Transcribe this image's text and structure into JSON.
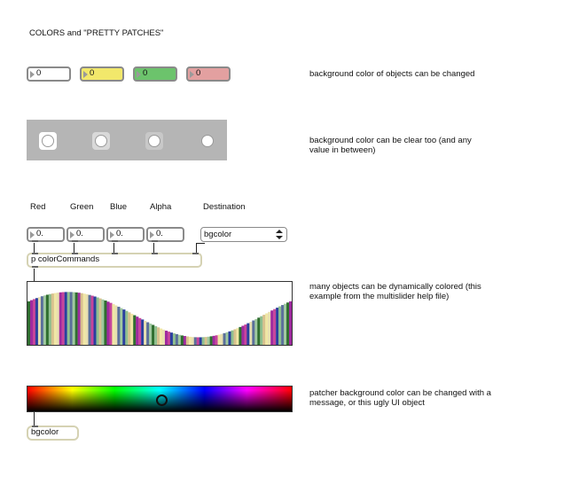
{
  "title": "COLORS and \"PRETTY PATCHES\"",
  "number_boxes": [
    {
      "value": "0",
      "color": "#ffffff"
    },
    {
      "value": "0",
      "color": "#f2e86b"
    },
    {
      "value": "0",
      "color": "#6cc36c"
    },
    {
      "value": "0",
      "color": "#e3a0a0"
    }
  ],
  "comments": {
    "bg_objects": "background color of objects can be changed",
    "bg_clear": "background color can be clear too (and any value in between)",
    "dynamic": "many objects can be dynamically colored (this example from the multislider help file)",
    "patcher_bg": "patcher background color can be changed with a message, or this ugly UI object"
  },
  "toggle_backgrounds": [
    "#ffffff",
    "#d9d9d9",
    "#c8c8c8",
    "#b5b5b5"
  ],
  "channel_labels": {
    "red": "Red",
    "green": "Green",
    "blue": "Blue",
    "alpha": "Alpha",
    "destination": "Destination"
  },
  "channel_values": {
    "red": "0.",
    "green": "0.",
    "blue": "0.",
    "alpha": "0."
  },
  "destination_menu": {
    "selected": "bgcolor"
  },
  "patcher_object": "p colorCommands",
  "multislider_bar_colors": [
    "#2f6e2f",
    "#2a3f9f",
    "#f0e7a5",
    "#a0c9a0",
    "#c7459b",
    "#d8c18e",
    "#5a6f9b",
    "#9f2a9f",
    "#8fbf8f",
    "#e8dfb0"
  ],
  "colorswatch_selected": "#00ffd8",
  "message_box": "bgcolor"
}
